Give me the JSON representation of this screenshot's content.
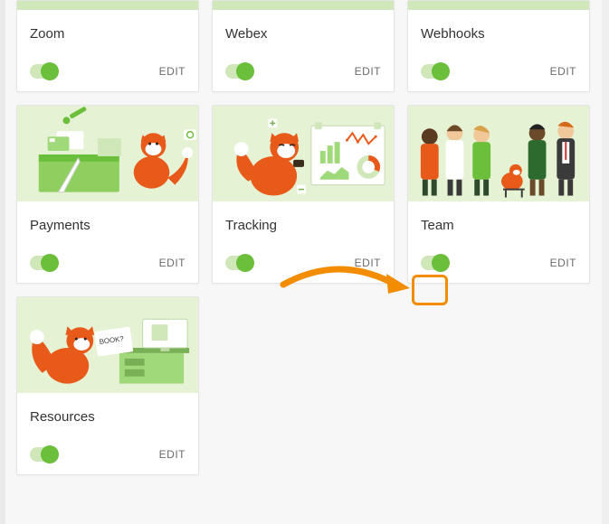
{
  "ui": {
    "edit_label": "EDIT"
  },
  "cards": {
    "zoom": {
      "title": "Zoom",
      "enabled": true
    },
    "webex": {
      "title": "Webex",
      "enabled": true
    },
    "webhooks": {
      "title": "Webhooks",
      "enabled": true
    },
    "payments": {
      "title": "Payments",
      "enabled": true
    },
    "tracking": {
      "title": "Tracking",
      "enabled": true
    },
    "team": {
      "title": "Team",
      "enabled": true
    },
    "resources": {
      "title": "Resources",
      "enabled": true
    }
  },
  "annotation": {
    "arrow_target": "team-toggle"
  }
}
